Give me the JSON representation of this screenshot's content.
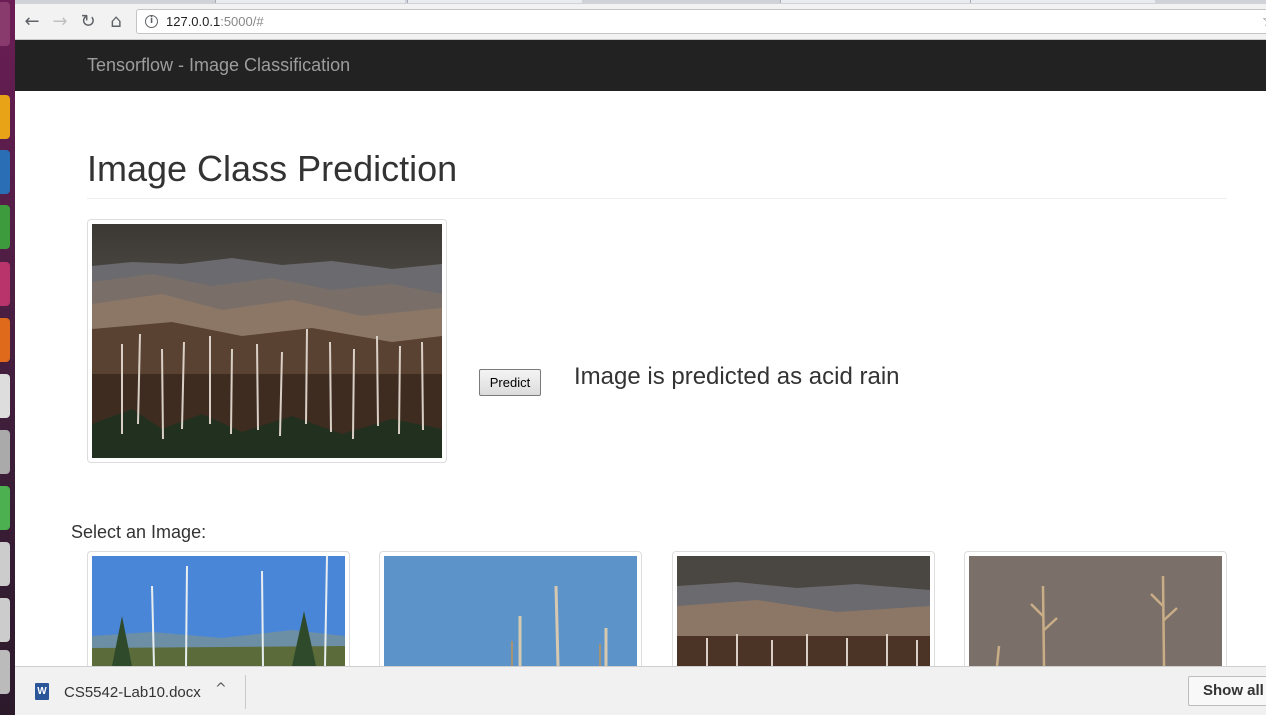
{
  "browser": {
    "url_host": "127.0.0.1",
    "url_rest": ":5000/#"
  },
  "navbar": {
    "brand": "Tensorflow - Image Classification"
  },
  "main": {
    "title": "Image Class Prediction",
    "predict_label": "Predict",
    "prediction_text": "Image is predicted as acid rain",
    "select_label": "Select an Image:"
  },
  "download_shelf": {
    "file_name": "CS5542-Lab10.docx",
    "doc_icon_letter": "W",
    "show_all_label": "Show all"
  },
  "colors": {
    "navbar_bg": "#222222",
    "brand_text": "#9d9d9d",
    "launcher": "#6b1d55"
  },
  "icons": [
    "back-arrow-icon",
    "forward-arrow-icon",
    "reload-icon",
    "home-icon",
    "info-icon",
    "bookmark-star-icon",
    "chevron-up-icon",
    "word-doc-icon"
  ]
}
